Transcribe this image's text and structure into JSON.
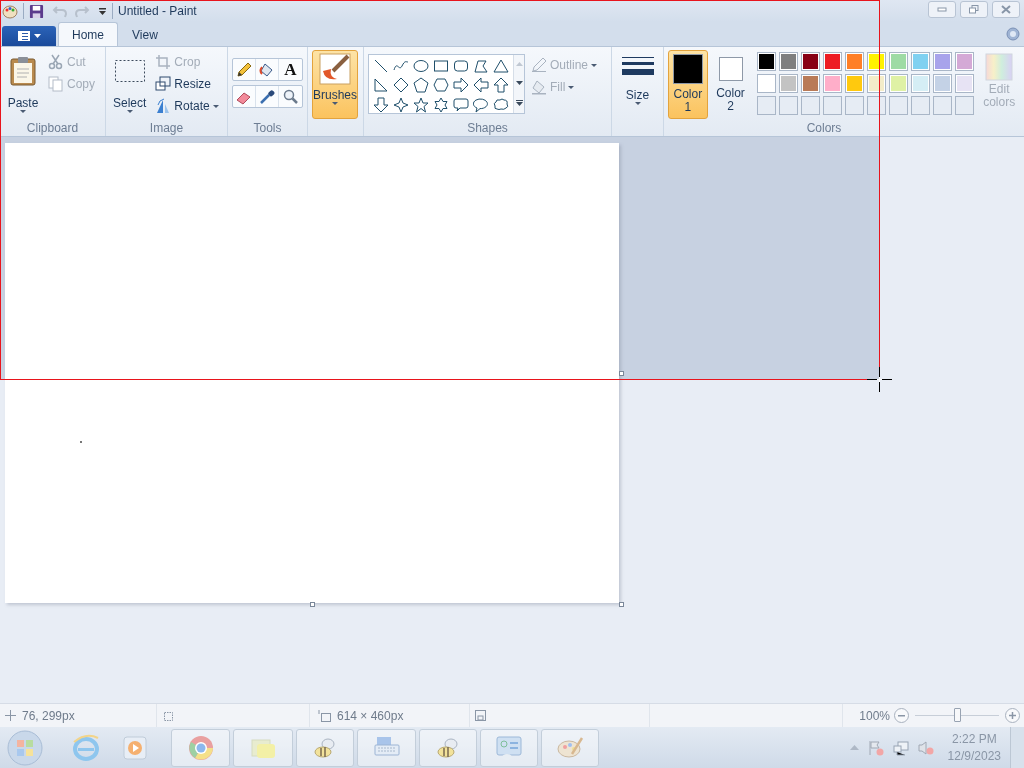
{
  "window": {
    "title": "Untitled - Paint"
  },
  "tabs": [
    {
      "label": "Home",
      "selected": true
    },
    {
      "label": "View",
      "selected": false
    }
  ],
  "ribbon": {
    "groups": [
      {
        "kind": "clipboard",
        "label": "Clipboard",
        "buttons": [
          {
            "label": "Paste",
            "disabled": false
          },
          {
            "label": "Cut",
            "disabled": true
          },
          {
            "label": "Copy",
            "disabled": true
          }
        ]
      },
      {
        "kind": "image",
        "label": "Image",
        "buttons": [
          {
            "label": "Select",
            "disabled": false
          },
          {
            "label": "Crop",
            "disabled": true
          },
          {
            "label": "Resize",
            "disabled": false
          },
          {
            "label": "Rotate",
            "disabled": false
          }
        ]
      },
      {
        "kind": "tools",
        "label": "Tools",
        "text_tool": "A"
      },
      {
        "kind": "brushes",
        "buttons": [
          {
            "label": "Brushes",
            "selected": true
          }
        ]
      },
      {
        "kind": "shapes",
        "label": "Shapes",
        "buttons": [
          {
            "label": "Outline",
            "disabled": true
          },
          {
            "label": "Fill",
            "disabled": true
          }
        ]
      },
      {
        "kind": "size",
        "buttons": [
          {
            "label": "Size"
          }
        ]
      },
      {
        "kind": "colors",
        "label": "Colors",
        "slots": [
          {
            "label": "Color 1",
            "selected": true,
            "color": "#000000"
          },
          {
            "label": "Color 2",
            "selected": false,
            "color": "#ffffff"
          }
        ],
        "palette": [
          [
            {
              "color": "#000000"
            },
            {
              "color": "#7f7f7f"
            },
            {
              "color": "#880015"
            },
            {
              "color": "#ed1c24"
            },
            {
              "color": "#ff7f27"
            },
            {
              "color": "#fff200"
            },
            {
              "color": "#9edba4"
            },
            {
              "color": "#80d1f1"
            },
            {
              "color": "#a8a3eb"
            },
            {
              "color": "#d4a9d6"
            }
          ],
          [
            {
              "color": "#ffffff"
            },
            {
              "color": "#c3c3c3"
            },
            {
              "color": "#b97a57"
            },
            {
              "color": "#ffaec9"
            },
            {
              "color": "#ffc90e"
            },
            {
              "color": "#f3ecc9"
            },
            {
              "color": "#dff1a5"
            },
            {
              "color": "#d5eef5"
            },
            {
              "color": "#c4d2e6"
            },
            {
              "color": "#e7e3f4"
            }
          ]
        ],
        "edit": {
          "label": "Edit colors",
          "disabled": true
        }
      }
    ]
  },
  "status_bar": {
    "cursor_position": "76, 299px",
    "canvas_size": "614 × 460px",
    "zoom": {
      "reading": "100%",
      "level": 0.5
    }
  },
  "taskbar": {
    "clock": {
      "time": "2:22 PM",
      "date": "12/9/2023"
    }
  }
}
